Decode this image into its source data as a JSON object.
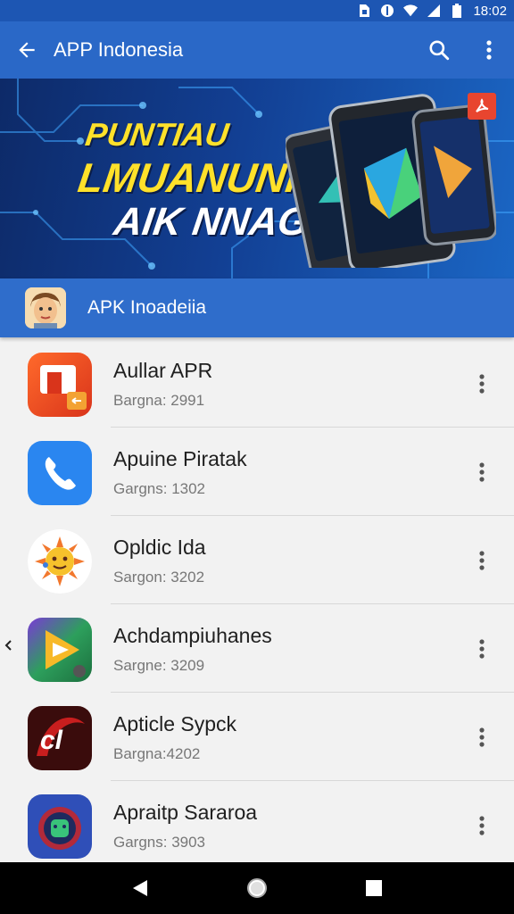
{
  "status_bar": {
    "time": "18:02"
  },
  "app_bar": {
    "title": "APP Indonesia"
  },
  "banner": {
    "line1": "PUNTIAU",
    "line2": "LMUANUNHA",
    "line3": "AIK NNAGA"
  },
  "sub_header": {
    "title": "APK Inoadeiia"
  },
  "apps": [
    {
      "name": "Aullar APR",
      "meta": "Bargna: 2991"
    },
    {
      "name": "Apuine Piratak",
      "meta": "Gargns: 1302"
    },
    {
      "name": "Opldic Ida",
      "meta": "Sargon: 3202"
    },
    {
      "name": "Achdampiuhanes",
      "meta": "Sargne: 3209"
    },
    {
      "name": "Apticle Sypck",
      "meta": "Bargna:4202"
    },
    {
      "name": "Apraitp Sararoa",
      "meta": "Gargns: 3903"
    }
  ],
  "colors": {
    "app_bar": "#2a68c7",
    "status_bar": "#1d56b3",
    "accent_yellow": "#ffe12a"
  }
}
